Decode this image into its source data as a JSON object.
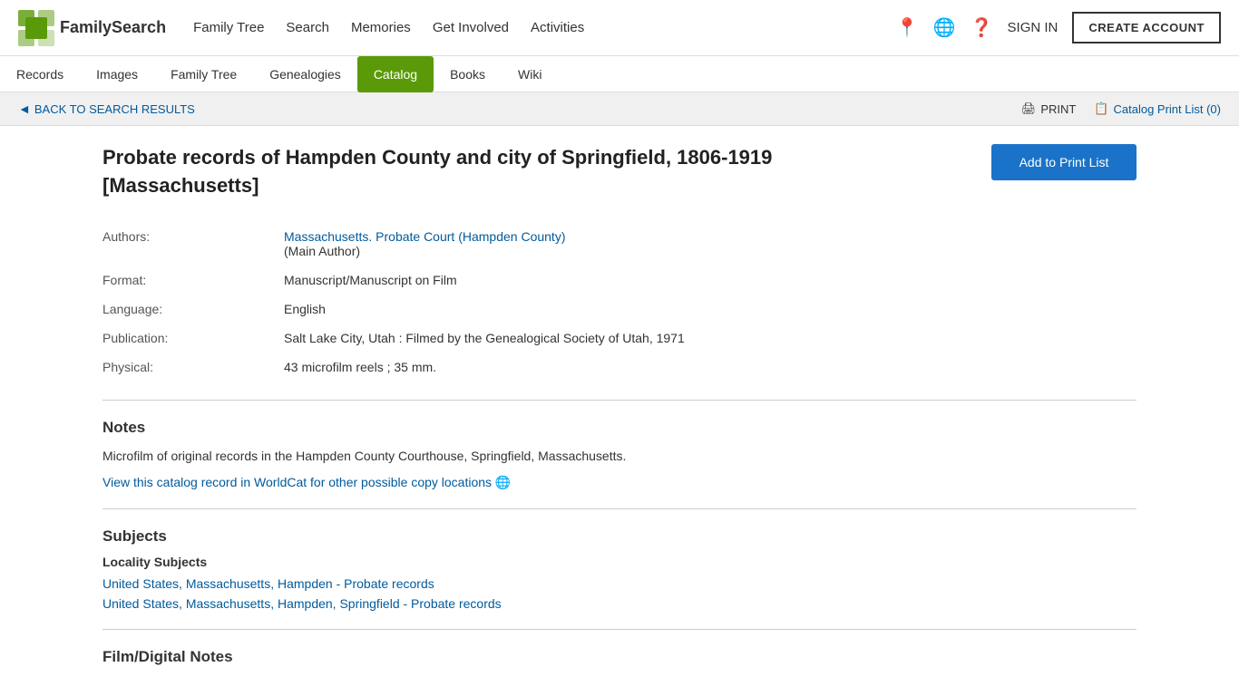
{
  "header": {
    "logo_text": "FamilySearch",
    "nav_links": [
      {
        "label": "Family Tree",
        "id": "family-tree"
      },
      {
        "label": "Search",
        "id": "search"
      },
      {
        "label": "Memories",
        "id": "memories"
      },
      {
        "label": "Get Involved",
        "id": "get-involved"
      },
      {
        "label": "Activities",
        "id": "activities"
      }
    ],
    "sign_in": "SIGN IN",
    "create_account": "CREATE ACCOUNT"
  },
  "secondary_nav": {
    "items": [
      {
        "label": "Records",
        "id": "records",
        "active": false
      },
      {
        "label": "Images",
        "id": "images",
        "active": false
      },
      {
        "label": "Family Tree",
        "id": "family-tree",
        "active": false
      },
      {
        "label": "Genealogies",
        "id": "genealogies",
        "active": false
      },
      {
        "label": "Catalog",
        "id": "catalog",
        "active": true
      },
      {
        "label": "Books",
        "id": "books",
        "active": false
      },
      {
        "label": "Wiki",
        "id": "wiki",
        "active": false
      }
    ]
  },
  "breadcrumb": {
    "back_label": "BACK TO SEARCH RESULTS",
    "print_label": "PRINT",
    "catalog_print_label": "Catalog Print List (0)"
  },
  "record": {
    "title": "Probate records of Hampden County and city of Springfield, 1806-1919 [Massachusetts]",
    "add_to_print_label": "Add to Print List",
    "fields": [
      {
        "label": "Authors:",
        "value": "Massachusetts. Probate Court (Hampden County)",
        "value2": "(Main Author)",
        "is_link": true
      },
      {
        "label": "Format:",
        "value": "Manuscript/Manuscript on Film",
        "is_link": false
      },
      {
        "label": "Language:",
        "value": "English",
        "is_link": false
      },
      {
        "label": "Publication:",
        "value": "Salt Lake City, Utah : Filmed by the Genealogical Society of Utah, 1971",
        "is_link": false
      },
      {
        "label": "Physical:",
        "value": "43 microfilm reels ; 35 mm.",
        "is_link": false
      }
    ]
  },
  "notes_section": {
    "title": "Notes",
    "content": "Microfilm of original records in the Hampden County Courthouse, Springfield, Massachusetts.",
    "worldcat_text": "View this catalog record in WorldCat for other possible copy locations"
  },
  "subjects_section": {
    "title": "Subjects",
    "subsection_title": "Locality Subjects",
    "subjects": [
      "United States, Massachusetts, Hampden - Probate records",
      "United States, Massachusetts, Hampden, Springfield - Probate records"
    ]
  },
  "film_section": {
    "title": "Film/Digital Notes"
  }
}
